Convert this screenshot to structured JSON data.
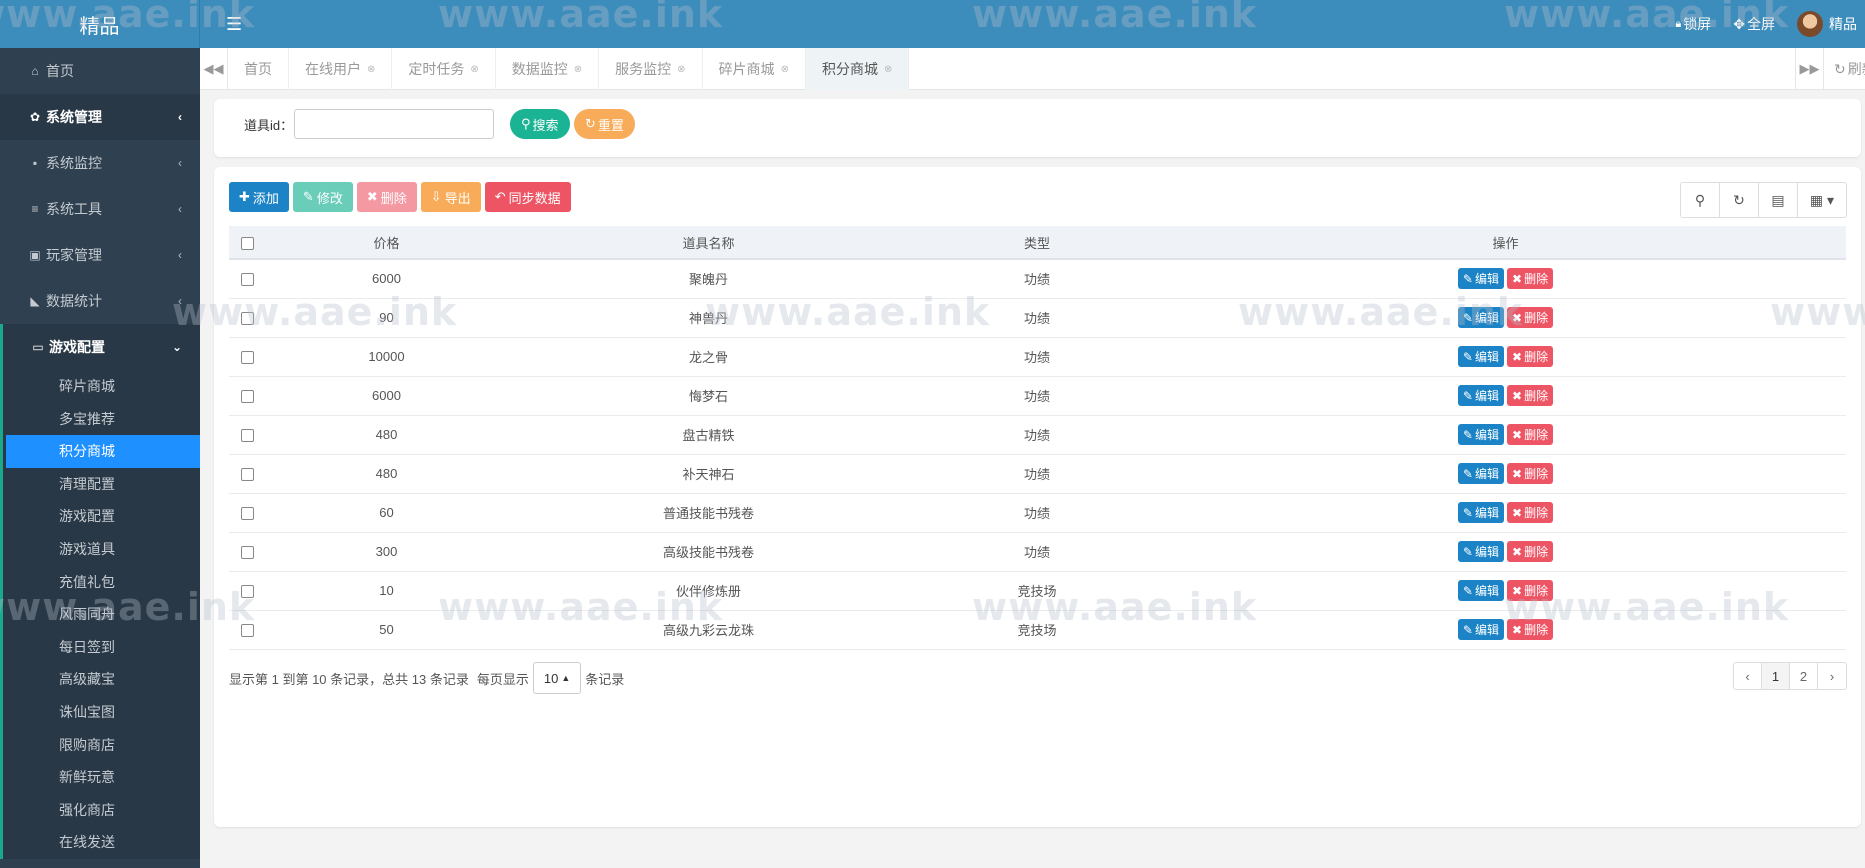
{
  "app": {
    "logo": "精品"
  },
  "header": {
    "lock_label": "锁屏",
    "fullscreen_label": "全屏",
    "user_name": "精品"
  },
  "sidebar": {
    "items": [
      {
        "label": "首页",
        "icon": "home-icon"
      },
      {
        "label": "系统管理",
        "icon": "gear-icon"
      },
      {
        "label": "系统监控",
        "icon": "video-icon"
      },
      {
        "label": "系统工具",
        "icon": "bars-icon"
      },
      {
        "label": "玩家管理",
        "icon": "user-card-icon"
      },
      {
        "label": "数据统计",
        "icon": "area-chart-icon"
      },
      {
        "label": "游戏配置",
        "icon": "desktop-icon"
      }
    ],
    "sub_items": [
      "碎片商城",
      "多宝推荐",
      "积分商城",
      "清理配置",
      "游戏配置",
      "游戏道具",
      "充值礼包",
      "风雨同舟",
      "每日签到",
      "高级藏宝",
      "诛仙宝图",
      "限购商店",
      "新鲜玩意",
      "强化商店",
      "在线发送"
    ]
  },
  "tabs": [
    {
      "label": "首页"
    },
    {
      "label": "在线用户"
    },
    {
      "label": "定时任务"
    },
    {
      "label": "数据监控"
    },
    {
      "label": "服务监控"
    },
    {
      "label": "碎片商城"
    },
    {
      "label": "积分商城"
    }
  ],
  "refresh_label": "刷新",
  "search": {
    "label": "道具id：",
    "value": "",
    "search_button": "搜索",
    "reset_button": "重置"
  },
  "toolbar": {
    "add": "添加",
    "edit": "修改",
    "delete": "删除",
    "export": "导出",
    "sync": "同步数据"
  },
  "table": {
    "columns": [
      "价格",
      "道具名称",
      "类型",
      "操作"
    ],
    "rows": [
      {
        "price": "6000",
        "name": "聚魄丹",
        "type": "功绩"
      },
      {
        "price": "90",
        "name": "神兽丹",
        "type": "功绩"
      },
      {
        "price": "10000",
        "name": "龙之骨",
        "type": "功绩"
      },
      {
        "price": "6000",
        "name": "悔梦石",
        "type": "功绩"
      },
      {
        "price": "480",
        "name": "盘古精铁",
        "type": "功绩"
      },
      {
        "price": "480",
        "name": "补天神石",
        "type": "功绩"
      },
      {
        "price": "60",
        "name": "普通技能书残卷",
        "type": "功绩"
      },
      {
        "price": "300",
        "name": "高级技能书残卷",
        "type": "功绩"
      },
      {
        "price": "10",
        "name": "伙伴修炼册",
        "type": "竞技场"
      },
      {
        "price": "50",
        "name": "高级九彩云龙珠",
        "type": "竞技场"
      }
    ],
    "edit_label": "编辑",
    "delete_label": "删除"
  },
  "pagination": {
    "summary": "显示第 1 到第 10 条记录，总共 13 条记录",
    "per_page_prefix": "每页显示",
    "page_size": "10",
    "per_page_suffix": "条记录",
    "prev": "‹",
    "pages": [
      "1",
      "2"
    ],
    "next": "›"
  },
  "watermark": "www.aae.ink"
}
